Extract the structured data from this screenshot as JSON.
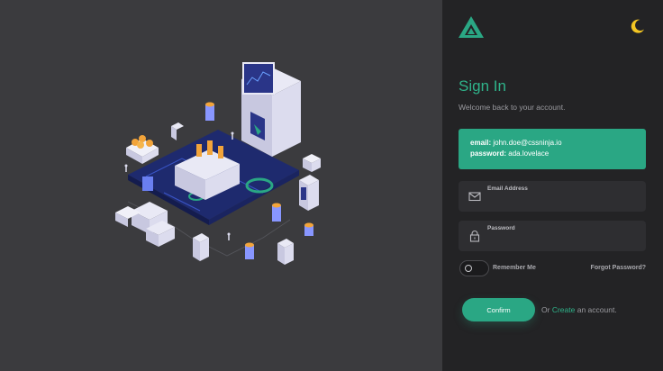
{
  "auth": {
    "title": "Sign In",
    "subtitle": "Welcome back to your account.",
    "demo": {
      "email_key": "email:",
      "email_value": "john.doe@cssninja.io",
      "password_key": "password:",
      "password_value": "ada.lovelace"
    },
    "email_field": {
      "label": "Email Address",
      "value": ""
    },
    "password_field": {
      "label": "Password",
      "value": ""
    },
    "remember_label": "Remember Me",
    "forgot_label": "Forgot Password?",
    "confirm_label": "Confirm",
    "alt_prefix": "Or",
    "create_label": "Create",
    "alt_suffix": "an account."
  },
  "icons": {
    "logo": "triangle-logo-icon",
    "theme": "moon-icon",
    "email": "mail-icon",
    "password": "lock-icon"
  },
  "colors": {
    "accent": "#2aa784",
    "panel": "#232325",
    "left_bg": "#3b3b3e",
    "moon": "#f3c623"
  }
}
